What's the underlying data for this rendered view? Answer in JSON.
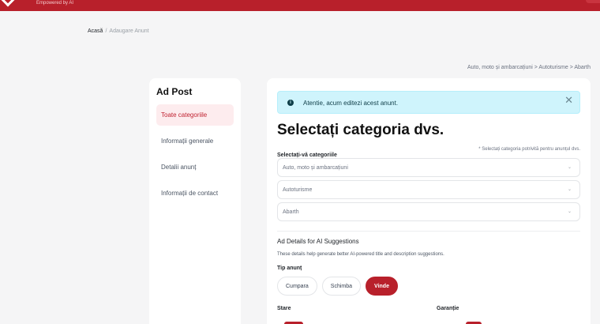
{
  "header": {
    "tagline": "Empowered by AI"
  },
  "breadcrumb": {
    "home": "Acasă",
    "separator": "/",
    "current": "Adaugare Anunt"
  },
  "category_path": "Auto, moto și ambarcațiuni > Autoturisme > Abarth",
  "sidebar": {
    "title": "Ad Post",
    "items": [
      {
        "label": "Toate categoriile"
      },
      {
        "label": "Informații generale"
      },
      {
        "label": "Detalii anunț"
      },
      {
        "label": "Informații de contact"
      }
    ]
  },
  "alert": {
    "message": "Atentie, acum editezi acest anunt.",
    "close": "✕"
  },
  "main": {
    "heading": "Selectați categoria dvs.",
    "select_label": "Selectați-vă categoriile",
    "select_hint": "* Selectați categoria potrivită pentru anunțul dvs.",
    "selects": [
      {
        "value": "Auto, moto și ambarcațiuni"
      },
      {
        "value": "Autoturisme"
      },
      {
        "value": "Abarth"
      }
    ],
    "ai_title": "Ad Details for AI Suggestions",
    "ai_desc": "These details help generate better AI-powered title and description suggestions.",
    "tip_label": "Tip anunț",
    "tip_options": [
      "Cumpara",
      "Schimba",
      "Vinde"
    ],
    "tip_selected": "Vinde",
    "stare_label": "Stare",
    "garantie_label": "Garanție"
  },
  "colors": {
    "brand": "#b8202b",
    "alert_bg": "#cff4fc",
    "active_item_bg": "#fdecee"
  },
  "icons": {
    "info": "info-icon",
    "close": "close-icon",
    "chevron": "chevron-down-icon"
  }
}
